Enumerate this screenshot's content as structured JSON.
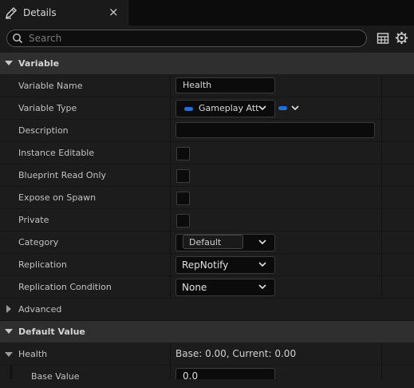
{
  "tab": {
    "title": "Details",
    "close": "×"
  },
  "search": {
    "placeholder": "Search",
    "value": ""
  },
  "sections": {
    "variable": "Variable",
    "default_value": "Default Value"
  },
  "properties": {
    "variable_name": {
      "label": "Variable Name",
      "value": "Health"
    },
    "variable_type": {
      "label": "Variable Type",
      "value": "Gameplay Att",
      "pin_color": "#1f6fe0"
    },
    "description": {
      "label": "Description",
      "value": ""
    },
    "instance_editable": {
      "label": "Instance Editable",
      "checked": false
    },
    "blueprint_read_only": {
      "label": "Blueprint Read Only",
      "checked": false
    },
    "expose_on_spawn": {
      "label": "Expose on Spawn",
      "checked": false
    },
    "private": {
      "label": "Private",
      "checked": false
    },
    "category": {
      "label": "Category",
      "value": "Default"
    },
    "replication": {
      "label": "Replication",
      "value": "RepNotify"
    },
    "replication_condition": {
      "label": "Replication Condition",
      "value": "None"
    },
    "advanced": {
      "label": "Advanced"
    }
  },
  "default_value": {
    "health": {
      "label": "Health",
      "summary": "Base: 0.00, Current: 0.00"
    },
    "base_value": {
      "label": "Base Value",
      "value": "0.0"
    }
  },
  "colors": {
    "accent_pin": "#1f6fe0",
    "section_bg": "#2f2f2f",
    "row_bg": "#1c1c1c"
  },
  "icons": {
    "tab": "pencil-icon",
    "search": "search-icon",
    "table": "table-icon",
    "settings": "gear-icon"
  }
}
